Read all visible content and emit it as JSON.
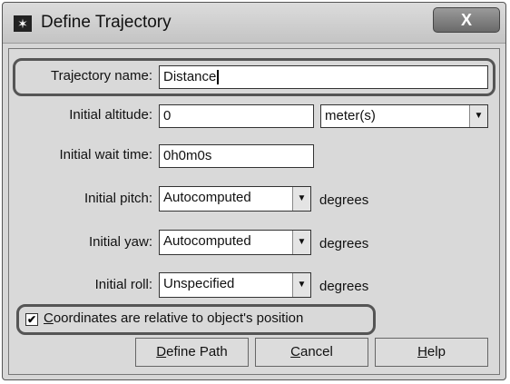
{
  "window": {
    "title": "Define Trajectory",
    "icon": "star-app-icon",
    "close_label": "X"
  },
  "form": {
    "trajectory_name": {
      "label": "Trajectory name:",
      "value": "Distance"
    },
    "initial_altitude": {
      "label": "Initial altitude:",
      "value": "0",
      "unit_selected": "meter(s)"
    },
    "initial_wait_time": {
      "label": "Initial wait time:",
      "value": "0h0m0s"
    },
    "initial_pitch": {
      "label": "Initial pitch:",
      "value": "Autocomputed",
      "unit": "degrees"
    },
    "initial_yaw": {
      "label": "Initial yaw:",
      "value": "Autocomputed",
      "unit": "degrees"
    },
    "initial_roll": {
      "label": "Initial roll:",
      "value": "Unspecified",
      "unit": "degrees"
    },
    "relative_coords": {
      "first_letter": "C",
      "rest": "oordinates are relative to object's position",
      "checked": true
    }
  },
  "buttons": {
    "define_path": {
      "mnemonic": "D",
      "rest": "efine Path"
    },
    "cancel": {
      "mnemonic": "C",
      "rest": "ancel"
    },
    "help": {
      "mnemonic": "H",
      "rest": "elp"
    }
  }
}
